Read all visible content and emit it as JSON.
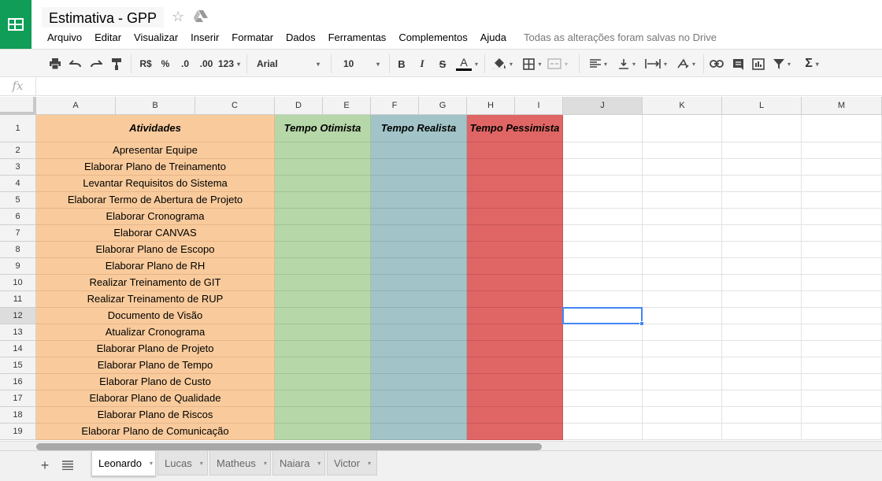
{
  "app": {
    "title": "Estimativa - GPP",
    "save_status": "Todas as alterações foram salvas no Drive",
    "brand_color": "#0f9d58"
  },
  "menu": [
    "Arquivo",
    "Editar",
    "Visualizar",
    "Inserir",
    "Formatar",
    "Dados",
    "Ferramentas",
    "Complementos",
    "Ajuda"
  ],
  "toolbar": {
    "currency": "R$",
    "percent": "%",
    "decrease_decimals": ".0",
    "increase_decimals": ".00",
    "more_formats": "123",
    "font": "Arial",
    "font_size": "10",
    "bold": "B",
    "italic": "I",
    "strike": "S",
    "text_color": "A",
    "functions": "Σ"
  },
  "formula_bar": {
    "icon": "fx",
    "value": ""
  },
  "columns": [
    "A",
    "B",
    "C",
    "D",
    "E",
    "F",
    "G",
    "H",
    "I",
    "J",
    "K",
    "L",
    "M"
  ],
  "rows": [
    "1",
    "2",
    "3",
    "4",
    "5",
    "6",
    "7",
    "8",
    "9",
    "10",
    "11",
    "12",
    "13",
    "14",
    "15",
    "16",
    "17",
    "18",
    "19"
  ],
  "header_row": {
    "activities": "Atividades",
    "optimistic": "Tempo Otimista",
    "realistic": "Tempo Realista",
    "pessimistic": "Tempo Pessimista"
  },
  "activities": [
    "Apresentar Equipe",
    "Elaborar Plano de Treinamento",
    "Levantar Requisitos do Sistema",
    "Elaborar Termo de Abertura de Projeto",
    "Elaborar Cronograma",
    "Elaborar CANVAS",
    "Elaborar Plano de Escopo",
    "Elaborar Plano de RH",
    "Realizar Treinamento de GIT",
    "Realizar Treinamento de RUP",
    "Documento de Visão",
    "Atualizar Cronograma",
    "Elaborar Plano de Projeto",
    "Elaborar Plano de Tempo",
    "Elaborar Plano de Custo",
    "Elaborar Plano de Qualidade",
    "Elaborar Plano de Riscos",
    "Elaborar Plano de Comunicação"
  ],
  "selected_cell": "J12",
  "colors": {
    "activities": "#f9cb9c",
    "optimistic": "#b6d7a8",
    "realistic": "#a2c4c9",
    "pessimistic": "#e06666",
    "selection": "#4285f4"
  },
  "sheets": [
    {
      "name": "Leonardo",
      "active": true
    },
    {
      "name": "Lucas",
      "active": false
    },
    {
      "name": "Matheus",
      "active": false
    },
    {
      "name": "Naiara",
      "active": false
    },
    {
      "name": "Victor",
      "active": false
    }
  ]
}
